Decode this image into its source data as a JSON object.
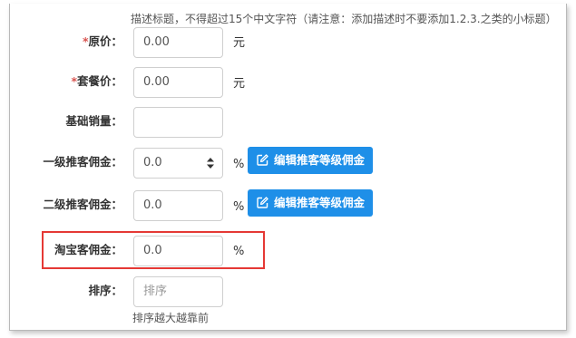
{
  "form": {
    "title_hint": "描述标题，不得超过15个中文字符（请注意：添加描述时不要添加1.2.3.之类的小标题）",
    "original_price": {
      "required_mark": "*",
      "label": "原价：",
      "value": "0.00",
      "unit": "元"
    },
    "package_price": {
      "required_mark": "*",
      "label": "套餐价：",
      "value": "0.00",
      "unit": "元"
    },
    "base_sales": {
      "label": "基础销量：",
      "value": ""
    },
    "level1_commission": {
      "label": "一级推客佣金：",
      "value": "0.0",
      "unit": "%",
      "button_label": "编辑推客等级佣金"
    },
    "level2_commission": {
      "label": "二级推客佣金：",
      "value": "0.0",
      "unit": "%",
      "button_label": "编辑推客等级佣金"
    },
    "taobao_commission": {
      "label": "淘宝客佣金：",
      "value": "0.0",
      "unit": "%"
    },
    "sort": {
      "label": "排序：",
      "placeholder": "排序",
      "hint": "排序越大越靠前"
    }
  },
  "colors": {
    "accent_button": "#1e8fe8",
    "required_mark": "#d9534f",
    "highlight_box": "#e53935"
  },
  "icons": {
    "edit": "edit-icon",
    "spinner": "spinner-icon"
  }
}
